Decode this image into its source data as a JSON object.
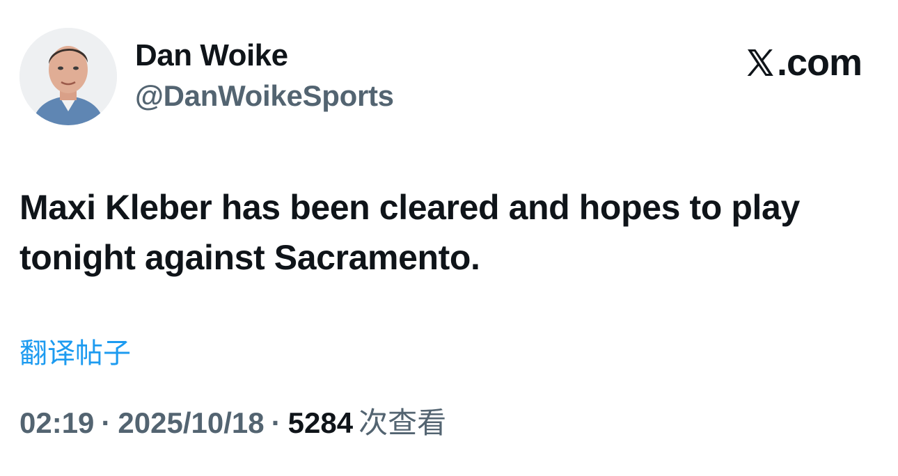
{
  "author": {
    "display_name": "Dan Woike",
    "handle": "@DanWoikeSports",
    "avatar_icon": "profile-photo"
  },
  "brand": {
    "logo_icon": "x-logo-icon",
    "text": ".com"
  },
  "tweet": {
    "text": "Maxi Kleber has been cleared and hopes to play tonight against Sacramento.",
    "translate_label": "翻译帖子"
  },
  "meta": {
    "time": "02:19",
    "separator": "·",
    "date": "2025/10/18",
    "views_count": "5284",
    "views_label": "次查看"
  },
  "colors": {
    "text_primary": "#0f1419",
    "text_secondary": "#536471",
    "link": "#1d9bf0"
  }
}
